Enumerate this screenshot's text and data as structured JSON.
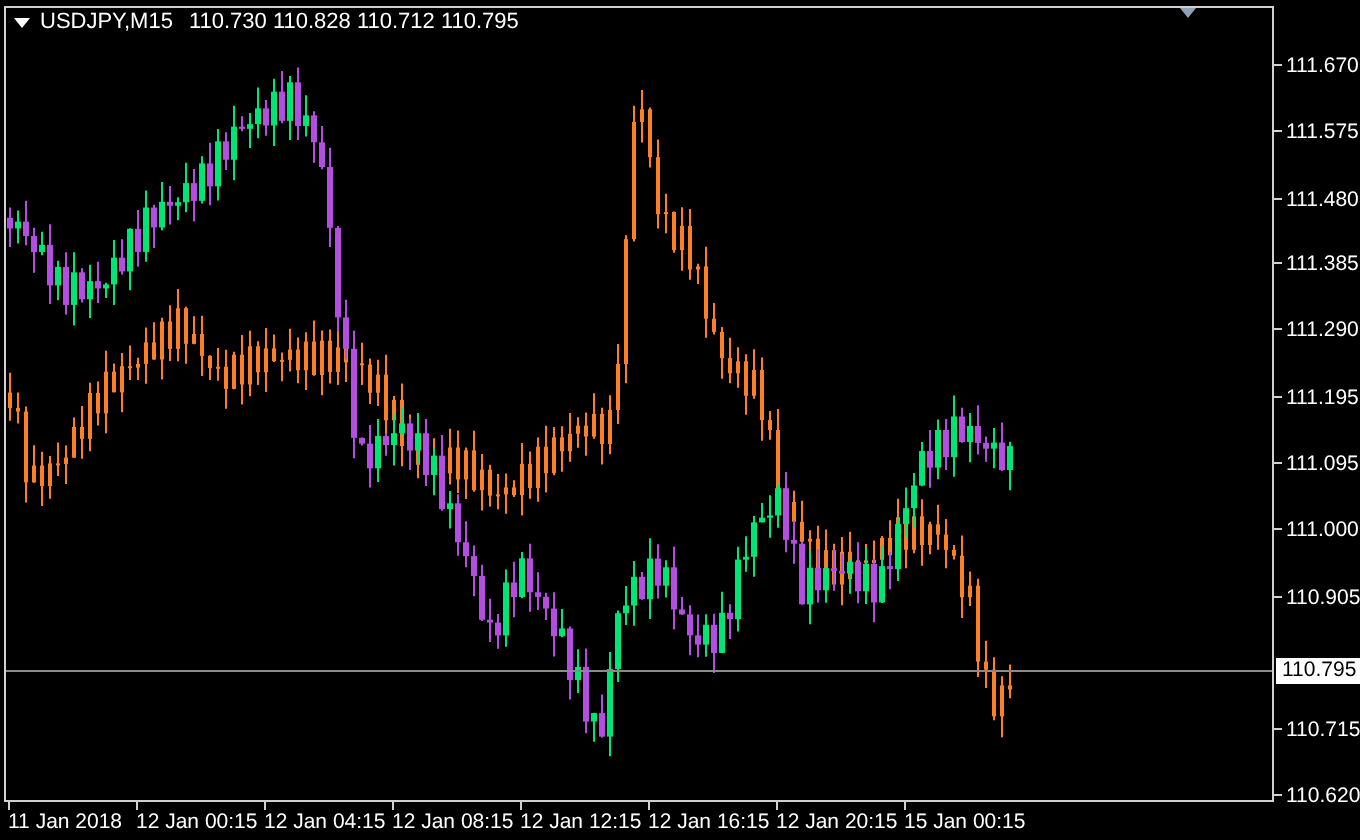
{
  "chart": {
    "symbol": "USDJPY,M15",
    "quote": "110.730 110.828 110.712 110.795",
    "price_label": "110.795",
    "y_ticks": [
      "111.670",
      "111.575",
      "111.480",
      "111.385",
      "111.290",
      "111.195",
      "111.095",
      "111.000",
      "110.905",
      "110.715",
      "110.620"
    ],
    "x_labels": [
      "11 Jan 2018",
      "12 Jan 00:15",
      "12 Jan 04:15",
      "12 Jan 08:15",
      "12 Jan 12:15",
      "12 Jan 16:15",
      "12 Jan 20:15",
      "15 Jan 00:15"
    ]
  }
}
